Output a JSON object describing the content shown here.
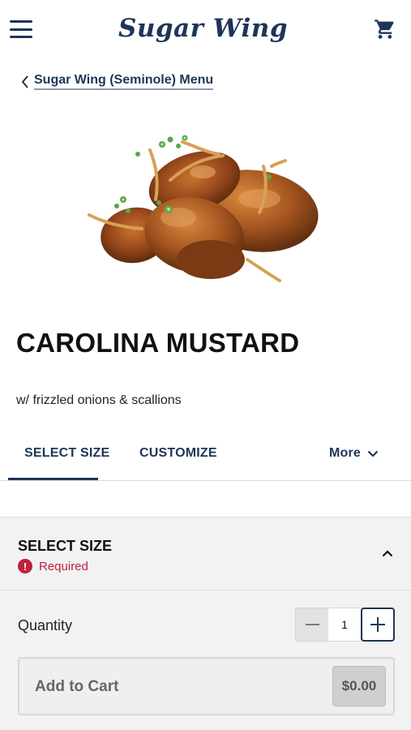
{
  "header": {
    "logo_text": "Sugar Wing",
    "menu_icon": "hamburger-menu-icon",
    "cart_icon": "shopping-cart-icon"
  },
  "breadcrumb": {
    "label": "Sugar Wing (Seminole) Menu",
    "icon": "chevron-left-icon"
  },
  "product": {
    "image": "chicken-wings-food-photo",
    "title": "CAROLINA MUSTARD",
    "description": "w/ frizzled onions & scallions"
  },
  "tabs": {
    "select_size": "SELECT SIZE",
    "customize": "CUSTOMIZE",
    "more": "More",
    "active": "SELECT SIZE"
  },
  "select_size": {
    "title": "SELECT SIZE",
    "required_label": "Required",
    "required_icon": "!",
    "expanded": true
  },
  "quantity": {
    "label": "Quantity",
    "value": "1"
  },
  "cart_button": {
    "label": "Add to Cart",
    "price": "$0.00"
  },
  "colors": {
    "brand_navy": "#1d3557",
    "required_red": "#c0203f",
    "section_bg": "#f2f2f2"
  }
}
